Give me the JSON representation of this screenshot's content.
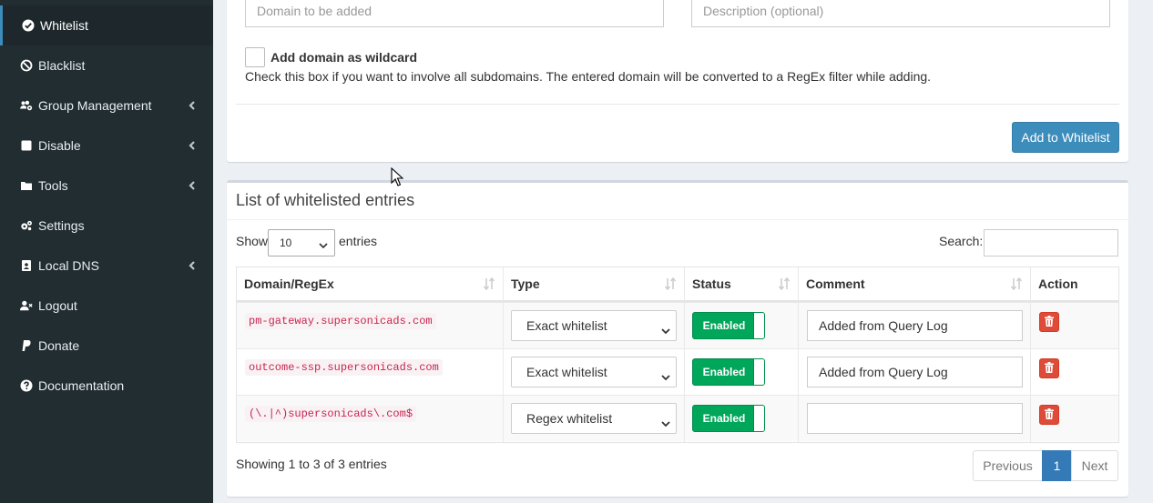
{
  "sidebar": {
    "items": [
      {
        "label": "Whitelist",
        "icon": "check-circle-icon",
        "active": true,
        "expandable": false
      },
      {
        "label": "Blacklist",
        "icon": "ban-icon",
        "active": false,
        "expandable": false
      },
      {
        "label": "Group Management",
        "icon": "users-cog-icon",
        "active": false,
        "expandable": true
      },
      {
        "label": "Disable",
        "icon": "stop-square-icon",
        "active": false,
        "expandable": true
      },
      {
        "label": "Tools",
        "icon": "folder-icon",
        "active": false,
        "expandable": true
      },
      {
        "label": "Settings",
        "icon": "cogs-icon",
        "active": false,
        "expandable": false
      },
      {
        "label": "Local DNS",
        "icon": "address-book-icon",
        "active": false,
        "expandable": true
      },
      {
        "label": "Logout",
        "icon": "user-times-icon",
        "active": false,
        "expandable": false
      },
      {
        "label": "Donate",
        "icon": "paypal-icon",
        "active": false,
        "expandable": false
      },
      {
        "label": "Documentation",
        "icon": "question-circle-icon",
        "active": false,
        "expandable": false
      }
    ]
  },
  "add_form": {
    "domain_placeholder": "Domain to be added",
    "description_placeholder": "Description (optional)",
    "wildcard_label": "Add domain as wildcard",
    "wildcard_checked": false,
    "wildcard_hint": "Check this box if you want to involve all subdomains. The entered domain will be converted to a RegEx filter while adding.",
    "add_button": "Add to Whitelist"
  },
  "list": {
    "title": "List of whitelisted entries",
    "show_label": "Show",
    "page_length": "10",
    "entries_label": "entries",
    "search_label": "Search:",
    "search_value": "",
    "columns": [
      "Domain/RegEx",
      "Type",
      "Status",
      "Comment",
      "Action"
    ],
    "rows": [
      {
        "domain": "pm-gateway.supersonicads.com",
        "type": "Exact whitelist",
        "status": "Enabled",
        "comment": "Added from Query Log"
      },
      {
        "domain": "outcome-ssp.supersonicads.com",
        "type": "Exact whitelist",
        "status": "Enabled",
        "comment": "Added from Query Log"
      },
      {
        "domain": "(\\.|^)supersonicads\\.com$",
        "type": "Regex whitelist",
        "status": "Enabled",
        "comment": ""
      }
    ],
    "info": "Showing 1 to 3 of 3 entries",
    "pagination": {
      "previous": "Previous",
      "current": "1",
      "next": "Next"
    }
  },
  "colors": {
    "sidebar_bg": "#222d32",
    "accent": "#3c8dbc",
    "enabled_green": "#00a65a",
    "delete_red": "#dd4b39",
    "code_red": "#c7254e"
  }
}
